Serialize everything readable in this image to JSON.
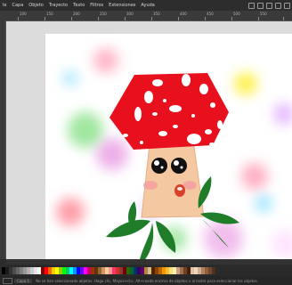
{
  "menubar": {
    "items": [
      "le",
      "Capa",
      "Objeto",
      "Trayecto",
      "Texto",
      "Filtros",
      "Extensiones",
      "Ayuda"
    ]
  },
  "ruler": {
    "labels": [
      "100",
      "150",
      "200",
      "250",
      "300",
      "350",
      "400",
      "450",
      "500",
      "550",
      "600"
    ]
  },
  "palette": {
    "colors": [
      "#000000",
      "#1a1a1a",
      "#333333",
      "#4d4d4d",
      "#666666",
      "#808080",
      "#999999",
      "#b3b3b3",
      "#cccccc",
      "#e6e6e6",
      "#ffffff",
      "#800000",
      "#ff0000",
      "#ff6600",
      "#ffcc00",
      "#ffff00",
      "#99cc00",
      "#00ff00",
      "#00cc66",
      "#00ffff",
      "#0099ff",
      "#0000ff",
      "#6600ff",
      "#ff00ff",
      "#cc0066",
      "#993300",
      "#663300",
      "#996633",
      "#cc9966",
      "#ffcc99",
      "#ff9999",
      "#ff3366",
      "#cc3333",
      "#993333",
      "#660000",
      "#336600",
      "#006633",
      "#003366",
      "#330066",
      "#660066",
      "#aa8844",
      "#ddbb88",
      "#552200",
      "#884400",
      "#bb6600",
      "#ee9900",
      "#ffbb33",
      "#ffdd77",
      "#fff0b3",
      "#c8a082",
      "#a07050",
      "#704020",
      "#402010",
      "#e0c0a0",
      "#f0d8c0",
      "#d0b090",
      "#b08060",
      "#906040",
      "#704830",
      "#503020"
    ]
  },
  "status": {
    "layer": "Capa 1",
    "message": "No se han seleccionado objetos. Haga clic, Mayús+clic, Alt+rueda encima de objetos o arrastre para seleccionar los objetos."
  },
  "colors": {
    "cap": "#e8101c",
    "stem": "#f4c8a0",
    "leaf": "#1f7d2a",
    "mouth": "#d8422a"
  }
}
